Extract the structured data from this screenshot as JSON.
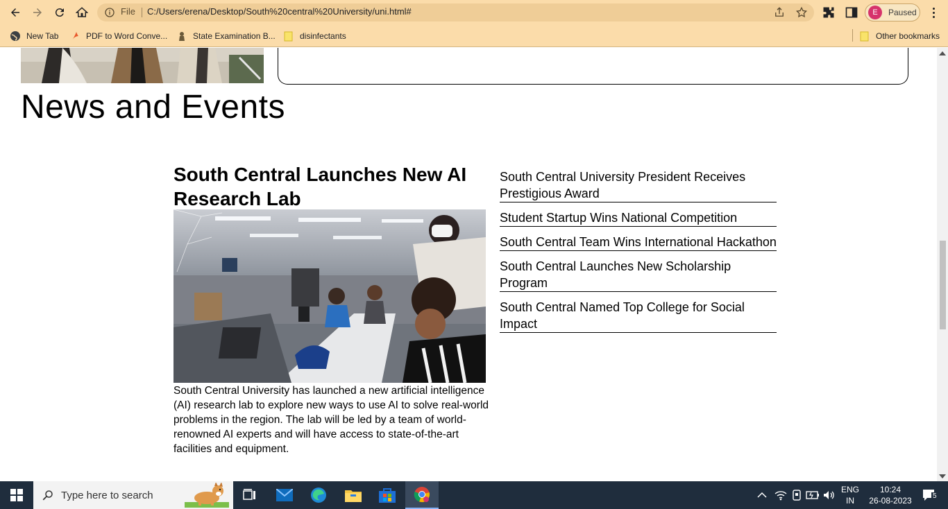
{
  "browser": {
    "omnibox_scheme": "File",
    "url": "C:/Users/erena/Desktop/South%20central%20University/uni.html#",
    "profile_initial": "E",
    "profile_status": "Paused"
  },
  "bookmarks": [
    {
      "label": "New Tab",
      "icon": "globe-icon"
    },
    {
      "label": "PDF to Word Conve...",
      "icon": "pdf-icon"
    },
    {
      "label": "State Examination B...",
      "icon": "seal-icon"
    },
    {
      "label": "disinfectants",
      "icon": "folder-icon"
    }
  ],
  "other_bookmarks": "Other bookmarks",
  "page": {
    "section_title": "News and Events",
    "feature": {
      "title": "South Central Launches New AI Research Lab",
      "body": "South Central University has launched a new artificial intelligence (AI) research lab to explore new ways to use AI to solve real-world problems in the region. The lab will be led by a team of world-renowned AI experts and will have access to state-of-the-art facilities and equipment."
    },
    "news": [
      "South Central University President Receives Prestigious Award",
      "Student Startup Wins National Competition",
      "South Central Team Wins International Hackathon",
      "South Central Launches New Scholarship Program",
      "South Central Named Top College for Social Impact"
    ]
  },
  "taskbar": {
    "search_placeholder": "Type here to search",
    "lang_primary": "ENG",
    "lang_secondary": "IN",
    "time": "10:24",
    "date": "26-08-2023",
    "notification_count": "5"
  },
  "colors": {
    "chrome_bg": "#fbdcaa",
    "omnibox_bg": "#efcd97",
    "taskbar_bg": "#1f2d3d",
    "avatar_bg": "#d6336c"
  }
}
